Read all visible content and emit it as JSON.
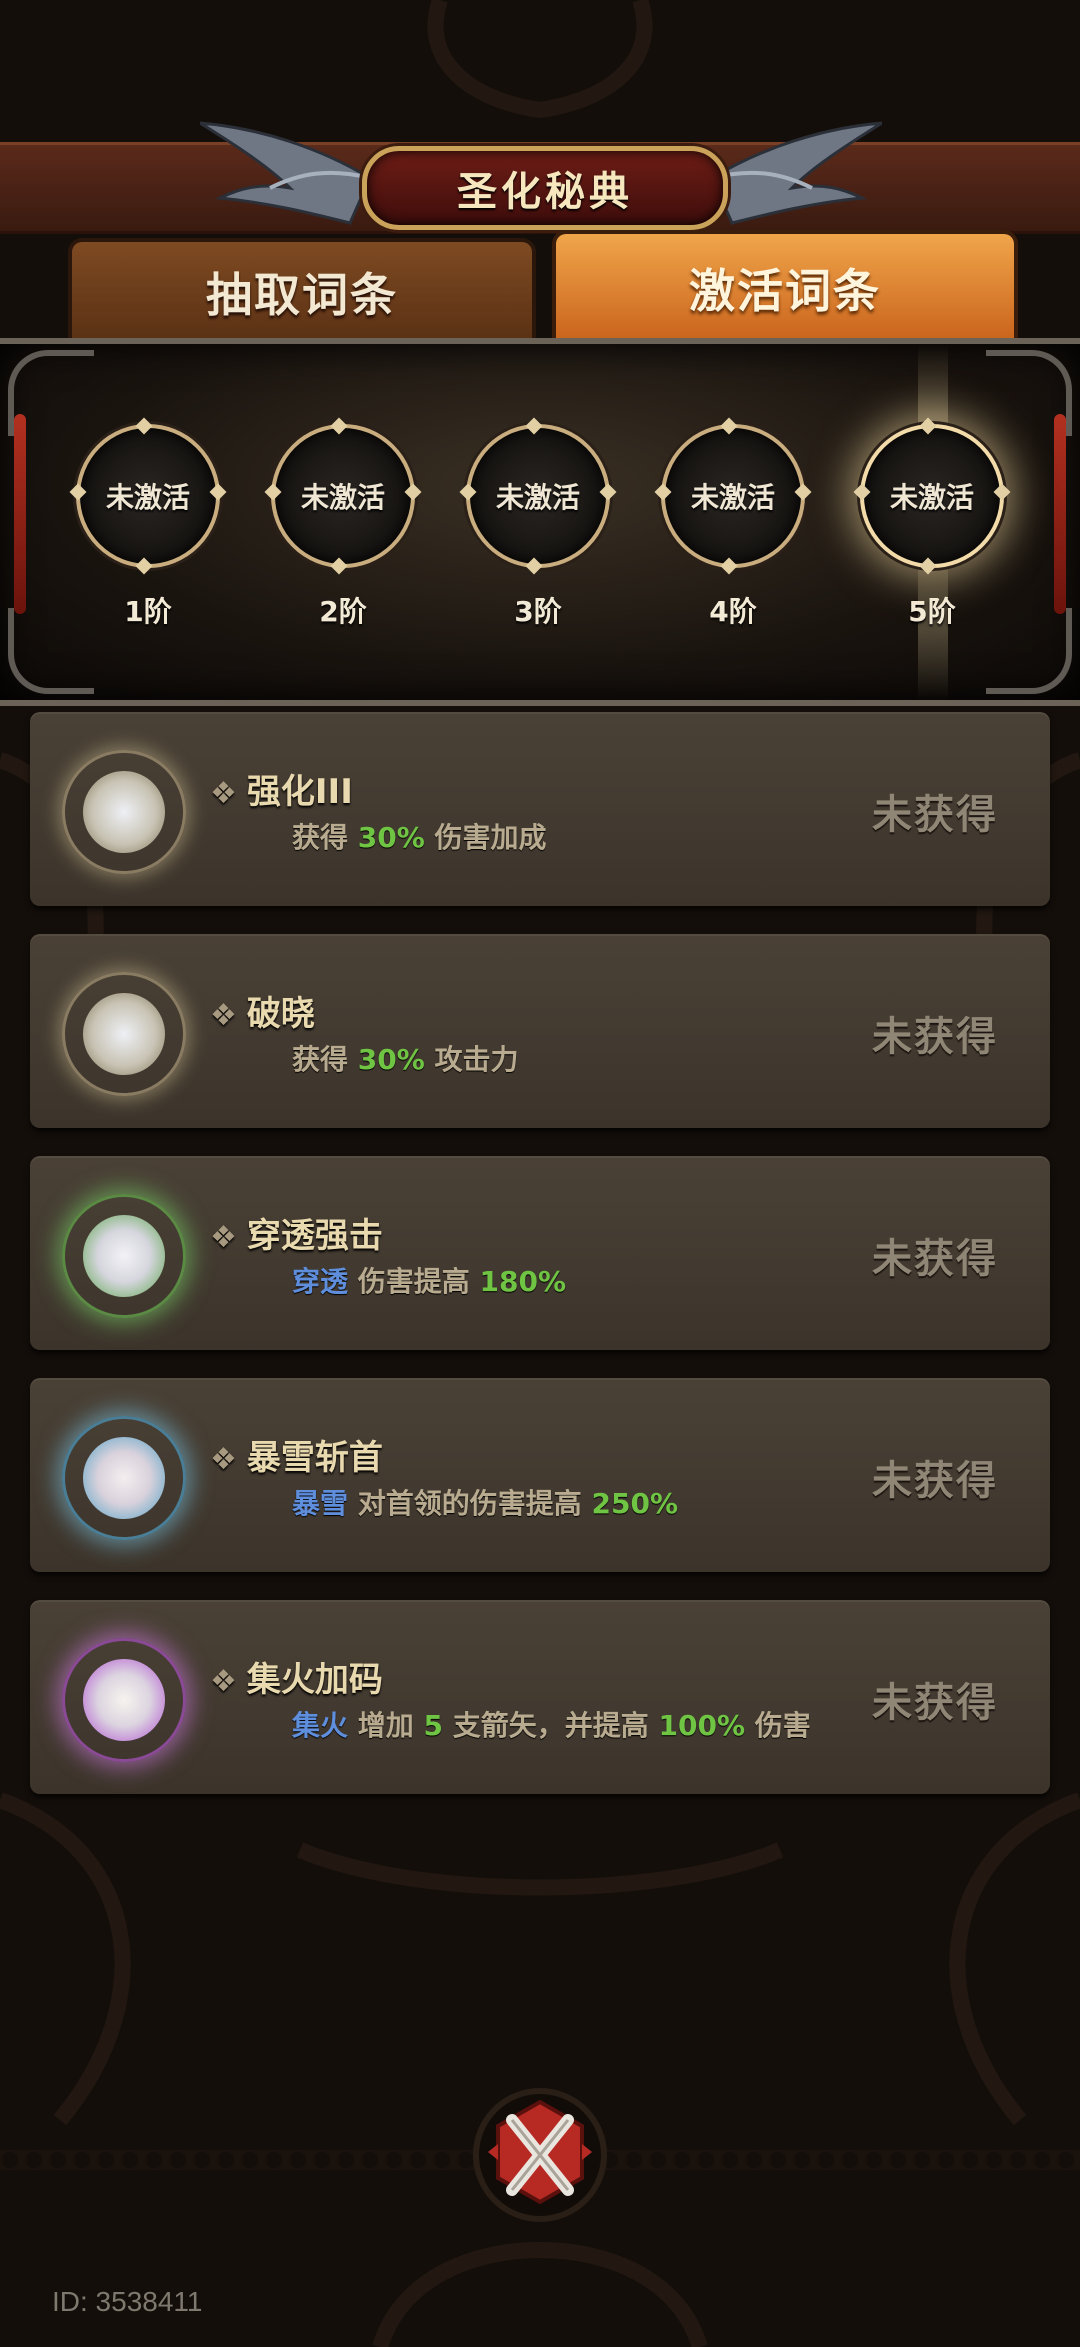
{
  "header": {
    "title": "圣化秘典"
  },
  "tabs": [
    {
      "label": "抽取词条",
      "active": false
    },
    {
      "label": "激活词条",
      "active": true
    }
  ],
  "tiers": [
    {
      "status": "未激活",
      "label": "1阶"
    },
    {
      "status": "未激活",
      "label": "2阶"
    },
    {
      "status": "未激活",
      "label": "3阶"
    },
    {
      "status": "未激活",
      "label": "4阶"
    },
    {
      "status": "未激活",
      "label": "5阶",
      "highlighted": true
    }
  ],
  "entries": [
    {
      "name": "强化III",
      "desc_parts": [
        "获得 ",
        "30%",
        " 伤害加成"
      ],
      "status": "未获得",
      "orb_color": "#d7c79a"
    },
    {
      "name": "破晓",
      "desc_parts": [
        "获得 ",
        "30%",
        " 攻击力"
      ],
      "status": "未获得",
      "orb_color": "#d7c79a"
    },
    {
      "name": "穿透强击",
      "desc_parts": [
        "穿透",
        " 伤害提高 ",
        "180%"
      ],
      "status": "未获得",
      "orb_color": "#7bd36a"
    },
    {
      "name": "暴雪斩首",
      "desc_parts": [
        "暴雪",
        " 对首领的伤害提高 ",
        "250%"
      ],
      "status": "未获得",
      "orb_color": "#7cc6e6"
    },
    {
      "name": "集火加码",
      "desc_parts": [
        "集火",
        " 增加 ",
        "5",
        " 支箭矢，并提高 ",
        "100%",
        " 伤害"
      ],
      "status": "未获得",
      "orb_color": "#d37ee6"
    }
  ],
  "footer": {
    "id_text": "ID: 3538411"
  },
  "icons": {
    "close": "close-x-icon",
    "diamond": "diamond-bullet-icon"
  },
  "colors": {
    "highlight_green": "#6fc443",
    "highlight_blue": "#5e8edc",
    "tab_active": "#e48d35"
  }
}
